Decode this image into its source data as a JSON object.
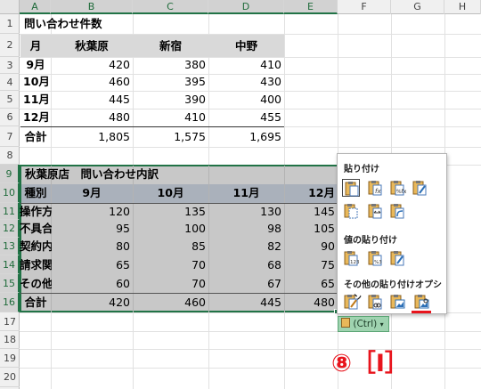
{
  "columns": [
    "A",
    "B",
    "C",
    "D",
    "E",
    "F",
    "G",
    "H"
  ],
  "rows": [
    "1",
    "2",
    "3",
    "4",
    "5",
    "6",
    "7",
    "8",
    "9",
    "10",
    "11",
    "12",
    "13",
    "14",
    "15",
    "16",
    "17",
    "18",
    "19",
    "20"
  ],
  "table1": {
    "title": "問い合わせ件数",
    "headers": [
      "月",
      "秋葉原",
      "新宿",
      "中野"
    ],
    "rows": [
      [
        "9月",
        "420",
        "380",
        "410"
      ],
      [
        "10月",
        "460",
        "395",
        "430"
      ],
      [
        "11月",
        "445",
        "390",
        "400"
      ],
      [
        "12月",
        "480",
        "410",
        "455"
      ]
    ],
    "total": [
      "合計",
      "1,805",
      "1,575",
      "1,695"
    ]
  },
  "table2": {
    "title": "秋葉原店　問い合わせ内訳",
    "headers": [
      "種別",
      "9月",
      "10月",
      "11月",
      "12月"
    ],
    "rows": [
      [
        "操作方法",
        "120",
        "135",
        "130",
        "145"
      ],
      [
        "不具合",
        "95",
        "100",
        "98",
        "105"
      ],
      [
        "契約内容",
        "80",
        "85",
        "82",
        "90"
      ],
      [
        "請求関連",
        "65",
        "70",
        "68",
        "75"
      ],
      [
        "その他",
        "60",
        "70",
        "67",
        "65"
      ]
    ],
    "total": [
      "合計",
      "420",
      "460",
      "445",
      "480"
    ]
  },
  "paste_menu": {
    "section1": "貼り付け",
    "section2": "値の貼り付け",
    "section3": "その他の貼り付けオプション"
  },
  "ctrl_button": "(Ctrl)",
  "annotation": "⑧［I］",
  "colors": {
    "selection_border": "#217346",
    "annotation": "#e8141c",
    "header_fill": "#d9d9d9",
    "table2_header_fill": "#aab1bb"
  }
}
